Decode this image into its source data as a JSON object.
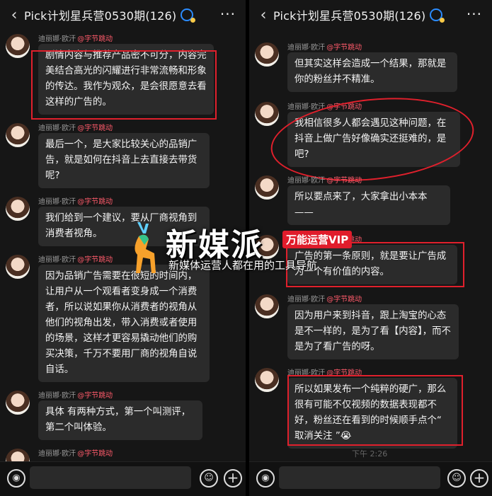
{
  "left": {
    "title": "Pick计划星兵营0530期(126)",
    "back_icon": "‹",
    "more_icon": "···",
    "messages": [
      {
        "sender": "迪丽娜·欧汗",
        "tag": "@字节跳动",
        "text": "剧情内容与推荐产品密不可分，内容完美结合高光的闪耀进行非常流畅和形象的传达。我作为观众，是会很愿意去看这样的广告的。"
      },
      {
        "sender": "迪丽娜·欧汗",
        "tag": "@字节跳动",
        "text": " 最后一个，是大家比较关心的品销广告，就是如何在抖音上去直接去带货呢?"
      },
      {
        "sender": "迪丽娜·欧汗",
        "tag": "@字节跳动",
        "text": "我们给到一个建议，要从厂商视角到消费者视角。"
      },
      {
        "sender": "迪丽娜·欧汗",
        "tag": "@字节跳动",
        "text": "因为品销广告需要在很短的时间内，让用户从一个观看者变身成一个消费者，所以说如果你从消费者的视角从他们的视角出发，带入消费或者使用的场景，这样才更容易撬动他们的购买决策，千万不要用厂商的视角自说自话。"
      },
      {
        "sender": "迪丽娜·欧汗",
        "tag": "@字节跳动",
        "text": "具体 有两种方式，第一个叫测评，第二个叫体验。"
      },
      {
        "sender": "迪丽娜·欧汗",
        "tag": "@字节跳动",
        "text": ""
      }
    ]
  },
  "right": {
    "title": "Pick计划星兵营0530期(126)",
    "back_icon": "‹",
    "more_icon": "···",
    "messages": [
      {
        "sender": "迪丽娜·欧汗",
        "tag": "@字节跳动",
        "text": "但其实这样会造成一个结果，那就是你的粉丝并不精准。"
      },
      {
        "sender": "迪丽娜·欧汗",
        "tag": "@字节跳动",
        "text": "我相信很多人都会遇见这种问题，在抖音上做广告好像确实还挺难的，是吧?"
      },
      {
        "sender": "迪丽娜·欧汗",
        "tag": "@字节跳动",
        "text": "所以要点来了，大家拿出小本本——"
      },
      {
        "sender": "迪丽娜·欧汗",
        "tag": "@字节跳动",
        "text": "广告的第一条原则，就是要让广告成为一个有价值的内容。"
      },
      {
        "sender": "迪丽娜·欧汗",
        "tag": "@字节跳动",
        "text": "因为用户来到抖音，跟上淘宝的心态是不一样的，是为了看【内容】，而不是为了看广告的呀。"
      },
      {
        "sender": "迪丽娜·欧汗",
        "tag": "@字节跳动",
        "text": "所以如果发布一个纯粹的硬广，那么很有可能不仅视频的数据表现都不好，粉丝还在看到的时候顺手点个“ 取消关注 ”😭"
      }
    ],
    "time_partial": "下午 2:26"
  },
  "watermark": {
    "name": "新媒派",
    "vip": "万能运营VIP",
    "subtitle": "新媒体运营人都在用的工具导航"
  },
  "bottom": {
    "voice_icon": "◉",
    "emoji_icon": "☺",
    "plus_icon": "+"
  },
  "colors": {
    "highlight": "#e0202c",
    "bubble": "#2b2b2b",
    "tag": "#ff5b6b"
  }
}
